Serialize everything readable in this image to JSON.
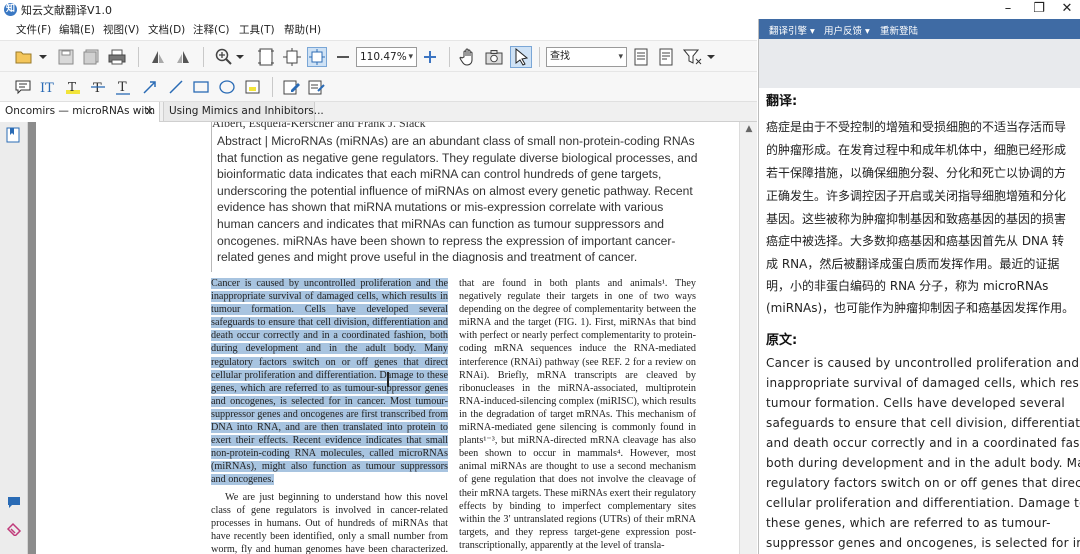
{
  "window": {
    "title": "知云文献翻译V1.0",
    "app_icon_letter": "知",
    "controls": [
      "–",
      "❐",
      "✕"
    ]
  },
  "menu": [
    "文件(F)",
    "编辑(E)",
    "视图(V)",
    "文档(D)",
    "注释(C)",
    "工具(T)",
    "帮助(H)"
  ],
  "toolbar": {
    "zoom_value": "110.47%",
    "find_value": "查找"
  },
  "tabs": [
    {
      "label": "Oncomirs — microRNAs with",
      "close": "✕"
    },
    {
      "label": "Using Mimics and Inhibitors..."
    }
  ],
  "document": {
    "abstract": "Abstract | MicroRNAs (miRNAs) are an abundant class of small non-protein-coding RNAs that function as negative gene regulators. They regulate diverse biological processes, and bioinformatic data indicates that each miRNA can control hundreds of gene targets, underscoring the potential influence of miRNAs on almost every genetic pathway. Recent evidence has shown that miRNA mutations or mis-expression correlate with various human cancers and indicates that miRNAs can function as tumour suppressors and oncogenes. miRNAs have been shown to repress the expression of important cancer-related genes and might prove useful in the diagnosis and treatment of cancer.",
    "clipped_heading": "Albert, Esquela-Kerscher and Frank J. Slack",
    "left_highlighted": "Cancer is caused by uncontrolled proliferation and the inappropriate survival of damaged cells, which results in tumour formation. Cells have developed several safeguards to ensure that cell division, differentiation and death occur correctly and in a coordinated fashion, both during development and in the adult body. Many regulatory factors switch on or off genes that direct cellular proliferation and differentiation. Damage to these genes, which are referred to as tumour-suppressor genes and oncogenes, is selected for in cancer. Most tumour-suppressor genes and oncogenes are first transcribed from DNA into RNA, and are then translated into protein to exert their effects. Recent evidence indicates that small non-protein-coding RNA molecules, called microRNAs (miRNAs), might also function as tumour suppressors and oncogenes.",
    "left_para2": "We are just beginning to understand how this novel class of gene regulators is involved in cancer-related processes in humans. Out of hundreds of miRNAs that have recently been identified, only a small number from worm, fly and human genomes have been characterized. They",
    "right_col": "that are found in both plants and animals¹. They negatively regulate their targets in one of two ways depending on the degree of complementarity between the miRNA and the target (FIG. 1). First, miRNAs that bind with perfect or nearly perfect complementarity to protein-coding mRNA sequences induce the RNA-mediated interference (RNAi) pathway (see REF. 2 for a review on RNAi). Briefly, mRNA transcripts are cleaved by ribonucleases in the miRNA-associated, multiprotein RNA-induced-silencing complex (miRISC), which results in the degradation of target mRNAs. This mechanism of miRNA-mediated gene silencing is commonly found in plants¹⁻³, but miRNA-directed mRNA cleavage has also been shown to occur in mammals⁴. However, most animal miRNAs are thought to use a second mechanism of gene regulation that does not involve the cleavage of their mRNA targets. These miRNAs exert their regulatory effects by binding to imperfect complementary sites within the 3′ untranslated regions (UTRs) of their mRNA targets, and they repress target-gene expression post-transcriptionally, apparently at the level of transla-"
  },
  "right_panel": {
    "links": [
      "翻译引擎 ▾",
      "用户反馈 ▾",
      "重新登陆"
    ],
    "translation_heading": "翻译:",
    "translation_lines": [
      "癌症是由于不受控制的增殖和受损细胞的不适当存活而导",
      "的肿瘤形成。在发育过程中和成年机体中，细胞已经形成",
      "若干保障措施，以确保细胞分裂、分化和死亡以协调的方",
      "正确发生。许多调控因子开启或关闭指导细胞增殖和分化",
      "基因。这些被称为肿瘤抑制基因和致癌基因的基因的损害",
      "癌症中被选择。大多数抑癌基因和癌基因首先从 DNA 转",
      "成 RNA，然后被翻译成蛋白质而发挥作用。最近的证据",
      "明，小的非蛋白编码的 RNA 分子，称为 microRNAs",
      "(miRNAs)，也可能作为肿瘤抑制因子和癌基因发挥作用。"
    ],
    "original_heading": "原文:",
    "original_lines": [
      "Cancer is caused by uncontrolled proliferation and the",
      "inappropriate survival of damaged cells, which results in",
      "tumour formation. Cells have developed several",
      "safeguards to ensure that cell division, differentiation",
      "and death occur correctly and in a coordinated fashion,",
      "both during development and in the adult body. Many",
      "regulatory factors switch on or off genes that direct",
      "cellular proliferation and differentiation. Damage to",
      "these genes, which are referred to as tumour-",
      "suppressor genes and oncogenes, is selected for in"
    ]
  }
}
